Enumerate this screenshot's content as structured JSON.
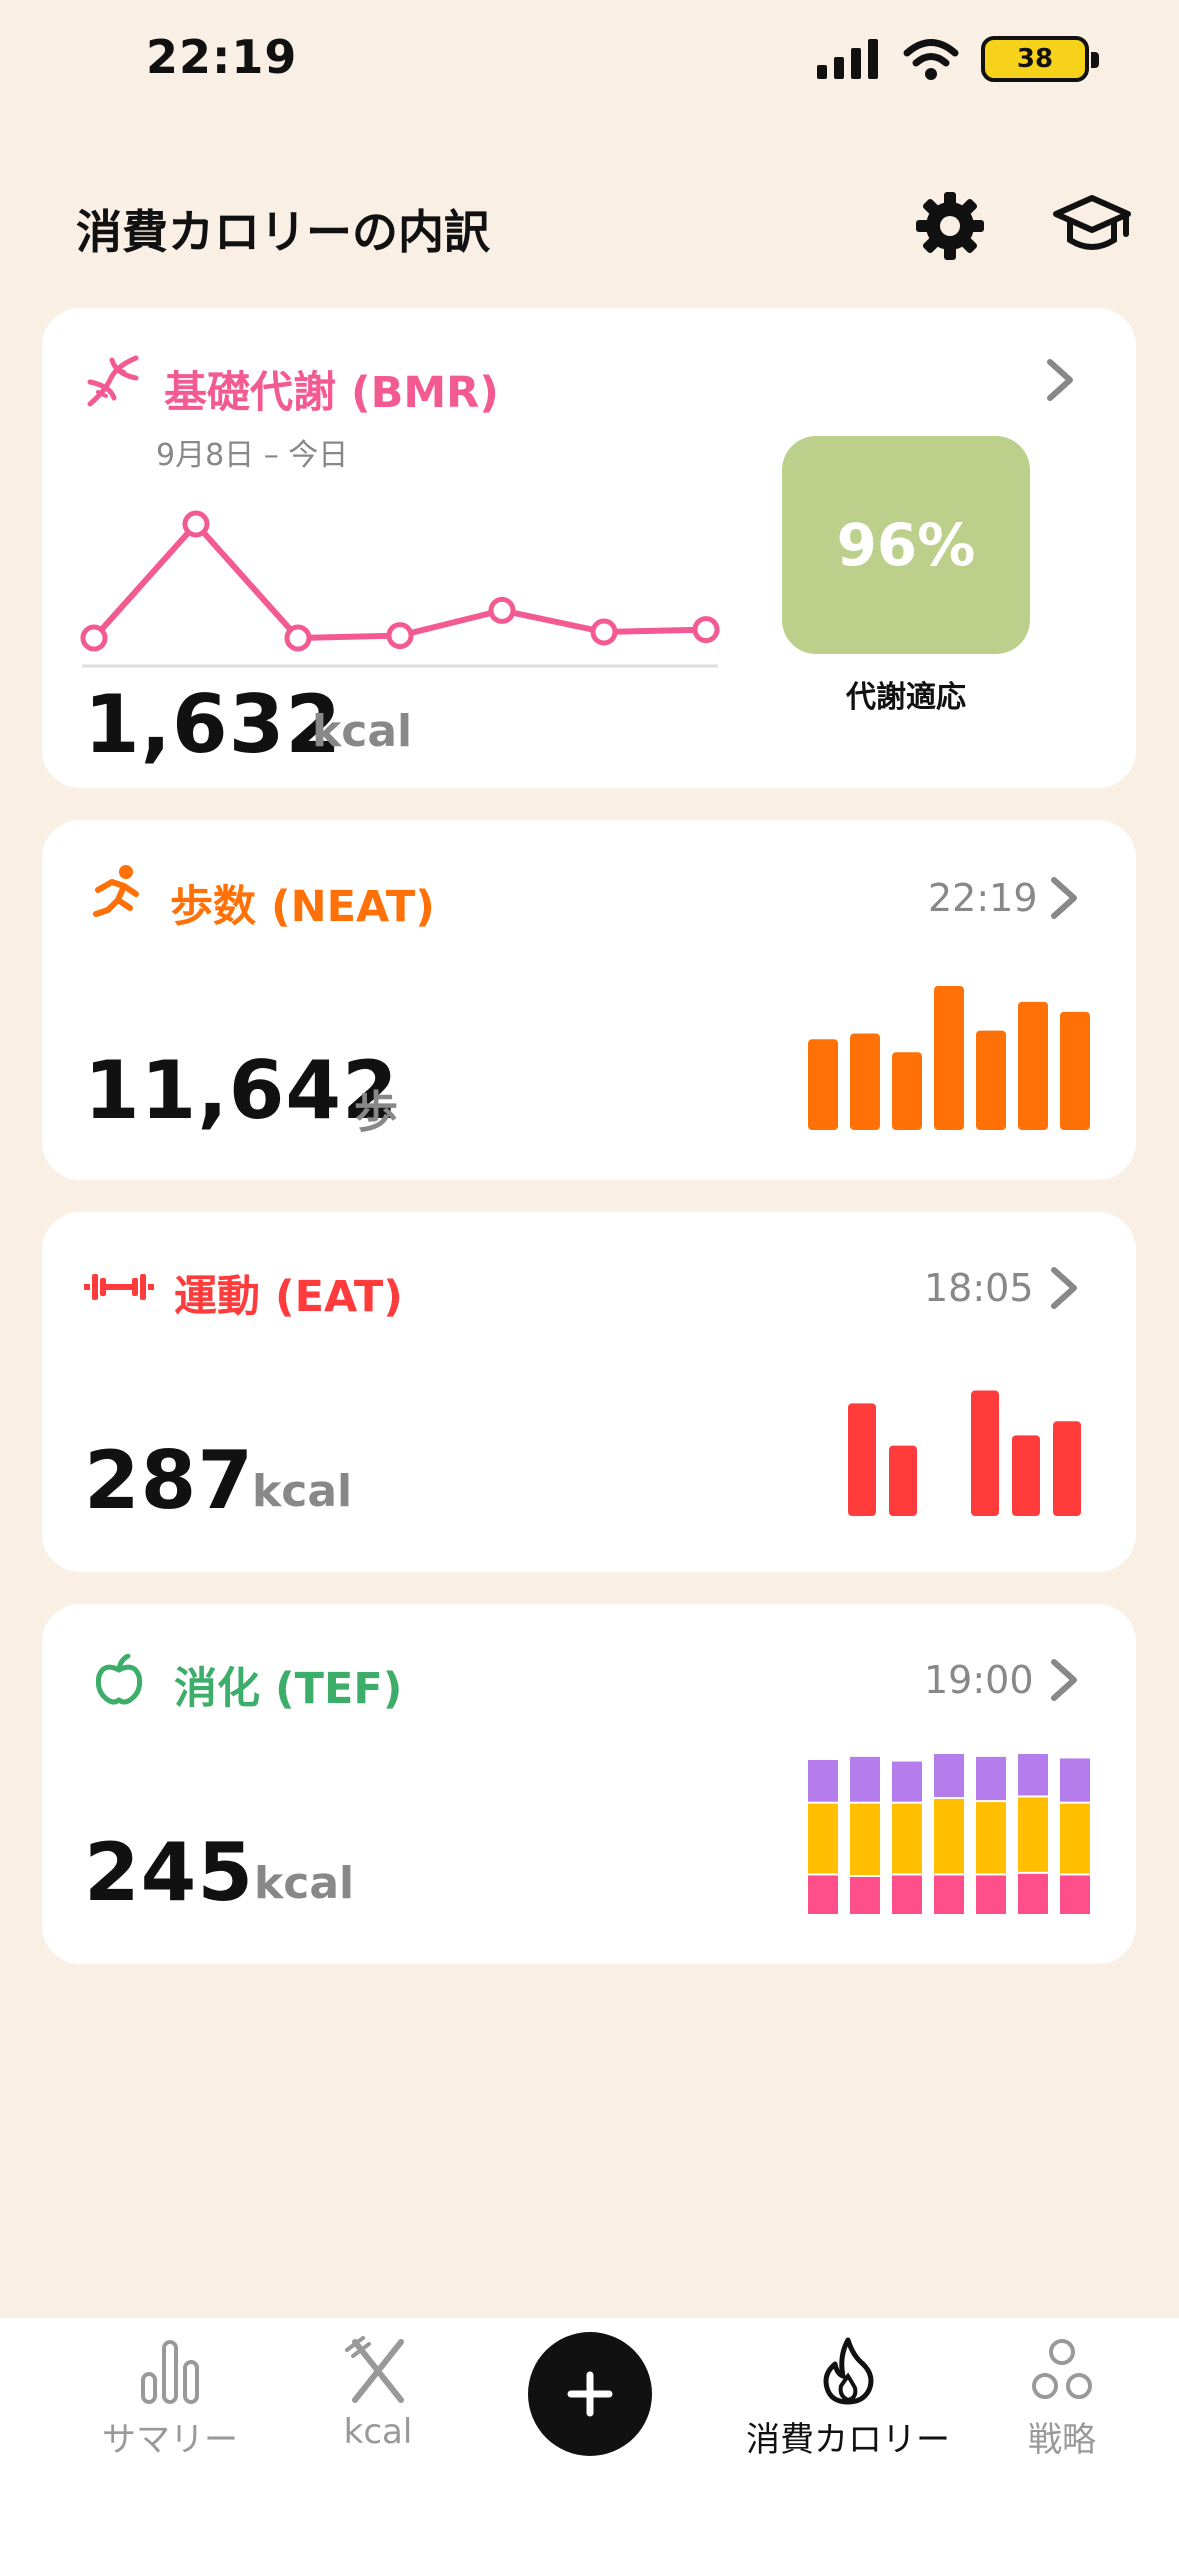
{
  "status": {
    "time": "22:19",
    "battery": "38"
  },
  "header": {
    "title": "消費カロリーの内訳"
  },
  "bmr": {
    "title": "基礎代謝 (BMR)",
    "date_range": "9月8日 – 今日",
    "value": "1,632",
    "unit": "kcal",
    "adaptation_pct": "96%",
    "adaptation_label": "代謝適応",
    "accent": "#f45a92",
    "adaptation_color": "#bcd08c",
    "trend": [
      1545,
      1640,
      1545,
      1547,
      1568,
      1550,
      1552
    ]
  },
  "neat": {
    "title": "歩数 (NEAT)",
    "time": "22:19",
    "value": "11,642",
    "unit": "歩",
    "accent": "#ff7006",
    "bars": [
      0.63,
      0.67,
      0.54,
      1.0,
      0.69,
      0.89,
      0.82
    ]
  },
  "eat": {
    "title": "運動 (EAT)",
    "time": "18:05",
    "value": "287",
    "unit": "kcal",
    "accent": "#ff3b3b",
    "bars": [
      0.88,
      0.55,
      0,
      0.98,
      0.63,
      0.74
    ]
  },
  "tef": {
    "title": "消化 (TEF)",
    "time": "19:00",
    "value": "245",
    "unit": "kcal",
    "accent": "#3cae6a",
    "segment_colors": [
      "#ff4f8b",
      "#ffbf00",
      "#b57cec"
    ],
    "stacks": [
      [
        0.26,
        0.46,
        0.28
      ],
      [
        0.25,
        0.47,
        0.3
      ],
      [
        0.26,
        0.46,
        0.27
      ],
      [
        0.26,
        0.49,
        0.29
      ],
      [
        0.26,
        0.47,
        0.29
      ],
      [
        0.27,
        0.49,
        0.3
      ],
      [
        0.26,
        0.46,
        0.29
      ]
    ]
  },
  "tabbar": {
    "summary": "サマリー",
    "kcal": "kcal",
    "burn": "消費カロリー",
    "strategy": "戦略"
  }
}
